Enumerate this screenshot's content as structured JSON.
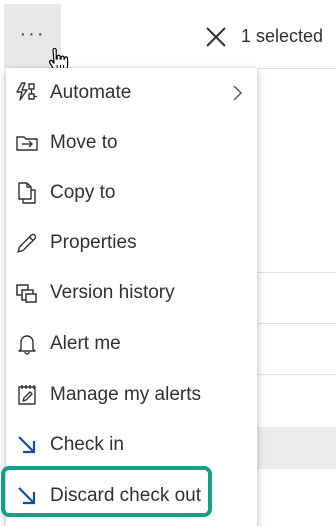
{
  "toolbar": {
    "more_label": "···",
    "selected_label": "1 selected"
  },
  "menu": {
    "items": [
      {
        "label": "Automate",
        "icon": "automate-icon"
      },
      {
        "label": "Move to",
        "icon": "move-to-icon"
      },
      {
        "label": "Copy to",
        "icon": "copy-icon"
      },
      {
        "label": "Properties",
        "icon": "pencil-icon"
      },
      {
        "label": "Version history",
        "icon": "version-history-icon"
      },
      {
        "label": "Alert me",
        "icon": "bell-icon"
      },
      {
        "label": "Manage my alerts",
        "icon": "manage-alerts-icon"
      },
      {
        "label": "Check in",
        "icon": "check-in-icon"
      },
      {
        "label": "Discard check out",
        "icon": "discard-checkout-icon"
      }
    ]
  },
  "colors": {
    "highlight": "#13a085",
    "accent_arrow": "#0f4fa8"
  }
}
